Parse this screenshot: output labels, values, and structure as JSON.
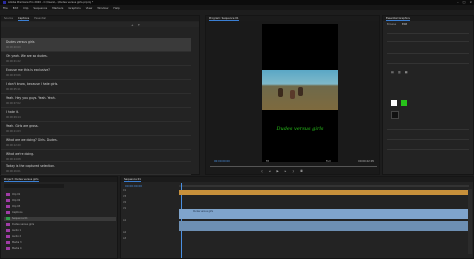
{
  "window": {
    "title": "Adobe Premiere Pro 2020 - C:\\Users\\...\\Dudes versus girls.prproj *"
  },
  "menu": [
    "File",
    "Edit",
    "Clip",
    "Sequence",
    "Markers",
    "Graphics",
    "View",
    "Window",
    "Help"
  ],
  "left_panel": {
    "tabs": [
      "Source",
      "Captions",
      "Essential"
    ],
    "active_tab": "Captions",
    "captions": [
      {
        "text": "Dudes versus girls",
        "time": "00:00:00:00",
        "selected": true
      },
      {
        "text": "Oh yeah. We are so dudes.",
        "time": "00:00:01:22"
      },
      {
        "text": "Excuse me this is exclusive?",
        "time": "00:00:03:06"
      },
      {
        "text": "I don't know, because I hate girls.",
        "time": "00:00:05:11"
      },
      {
        "text": "Yeah. Hey you guys. Yeah. Yeah.",
        "time": "00:00:07:02"
      },
      {
        "text": "I hate it.",
        "time": "00:00:09:14"
      },
      {
        "text": "Yeah. Girls are gross.",
        "time": "00:00:11:03"
      },
      {
        "text": "What are we doing? Girls. Dudes.",
        "time": "00:00:12:20"
      },
      {
        "text": "What we're doing.",
        "time": "00:00:14:08"
      },
      {
        "text": "Today is the captured selection.",
        "time": "00:00:16:01"
      }
    ]
  },
  "program": {
    "tab": "Program: Sequence 01",
    "subtitle": "Dudes versus girls",
    "timecode": "00:00:00:00",
    "duration": "00:00:22:05",
    "fit": "Fit",
    "quality": "Full"
  },
  "right_panel": {
    "title": "Essential Graphics",
    "tabs": [
      "Browse",
      "Edit"
    ]
  },
  "project": {
    "tab": "Project: Dudes versus girls",
    "items": [
      "Clip 01",
      "Clip 02",
      "Clip 03",
      "Captions",
      "Sequence 01",
      "Dudes versus girls",
      "Audio 1",
      "Audio 2",
      "Media 3",
      "Media 4"
    ]
  },
  "timeline": {
    "tab": "Sequence 01",
    "timecode": "00:00:00:00",
    "tracks": [
      "C1",
      "V3",
      "V2",
      "V1",
      "A1",
      "A2",
      "A3"
    ],
    "clip_label": "Dudes versus girls"
  },
  "colors": {
    "accent": "#3a7fd4",
    "subtitle": "#27c21a",
    "caption_track": "#c7903b",
    "video_track": "#7fa4cc"
  }
}
